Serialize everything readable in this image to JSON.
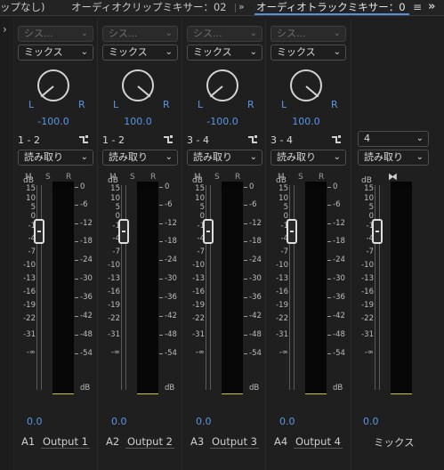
{
  "tabs": [
    {
      "label": "ップなし)"
    },
    {
      "label": "オーディオクリップミキサー：02"
    },
    {
      "label": "オーディオトラックミキサー：0"
    }
  ],
  "tab_menu_icon": "hamburger-icon",
  "tab_more_icon": "double-chevron-right-icon",
  "tracks": [
    {
      "input": "シス...",
      "effect": "ミックス",
      "L": "L",
      "R": "R",
      "pan": "-100.0",
      "channels": "1 - 2",
      "automation": "読み取り",
      "m": "M",
      "s": "S",
      "r": "R",
      "volume": "0.0",
      "track": "A1",
      "output": "Output 1"
    },
    {
      "input": "シス...",
      "effect": "ミックス",
      "L": "L",
      "R": "R",
      "pan": "100.0",
      "channels": "1 - 2",
      "automation": "読み取り",
      "m": "M",
      "s": "S",
      "r": "R",
      "volume": "0.0",
      "track": "A2",
      "output": "Output 2"
    },
    {
      "input": "シス...",
      "effect": "ミックス",
      "L": "L",
      "R": "R",
      "pan": "-100.0",
      "channels": "3 - 4",
      "automation": "読み取り",
      "m": "M",
      "s": "S",
      "r": "R",
      "volume": "0.0",
      "track": "A3",
      "output": "Output 3"
    },
    {
      "input": "シス...",
      "effect": "ミックス",
      "L": "L",
      "R": "R",
      "pan": "100.0",
      "channels": "3 - 4",
      "automation": "読み取り",
      "m": "M",
      "s": "S",
      "r": "R",
      "volume": "0.0",
      "track": "A4",
      "output": "Output 4"
    }
  ],
  "master": {
    "channels": "4",
    "automation": "読み取り",
    "volume": "0.0",
    "name": "ミックス"
  },
  "meter_scale": {
    "top": "dB",
    "ticks": [
      "0",
      "-6",
      "-12",
      "-18",
      "-24",
      "-30",
      "-36",
      "-42",
      "-48",
      "-54"
    ],
    "bottom": "dB"
  },
  "fader_scale": {
    "top": "dB",
    "ticks": [
      "15",
      "10",
      "5",
      "0",
      "-1",
      "-4",
      "-7",
      "-10",
      "-13",
      "-16",
      "-19",
      "-22",
      "-31",
      "-∞"
    ]
  },
  "colors": {
    "accent_blue": "#5a95e6",
    "meter_floor": "#cfc440"
  }
}
